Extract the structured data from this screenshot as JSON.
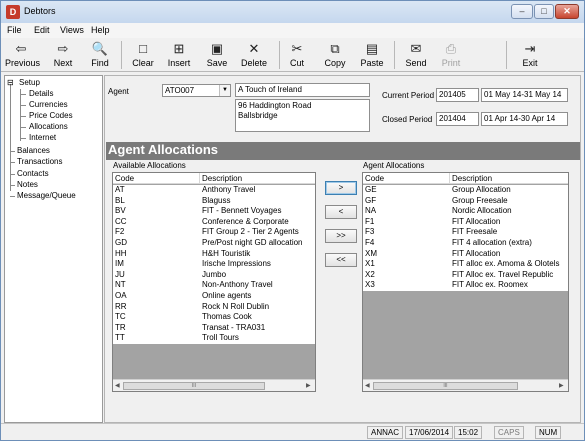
{
  "window": {
    "title": "Debtors",
    "icon_letter": "D"
  },
  "menu": [
    "File",
    "Edit",
    "Views",
    "Help"
  ],
  "toolbar": [
    {
      "label": "Previous",
      "icon": "previous-icon",
      "glyph": "⇦",
      "enabled": true
    },
    {
      "label": "Next",
      "icon": "next-icon",
      "glyph": "⇨",
      "enabled": true
    },
    {
      "label": "Find",
      "icon": "binoculars-icon",
      "glyph": "🔍",
      "enabled": true
    },
    {
      "label": "Clear",
      "icon": "clear-page-icon",
      "glyph": "□",
      "enabled": true
    },
    {
      "label": "Insert",
      "icon": "insert-page-icon",
      "glyph": "⊞",
      "enabled": true
    },
    {
      "label": "Save",
      "icon": "save-icon",
      "glyph": "▣",
      "enabled": true
    },
    {
      "label": "Delete",
      "icon": "delete-icon",
      "glyph": "✕",
      "enabled": true
    },
    {
      "label": "Cut",
      "icon": "scissors-icon",
      "glyph": "✂",
      "enabled": true
    },
    {
      "label": "Copy",
      "icon": "copy-icon",
      "glyph": "⧉",
      "enabled": true
    },
    {
      "label": "Paste",
      "icon": "paste-icon",
      "glyph": "▤",
      "enabled": true
    },
    {
      "label": "Send",
      "icon": "send-icon",
      "glyph": "✉",
      "enabled": true
    },
    {
      "label": "Print",
      "icon": "printer-icon",
      "glyph": "⎙",
      "enabled": false
    },
    {
      "label": "Exit",
      "icon": "exit-door-icon",
      "glyph": "⇥",
      "enabled": true
    }
  ],
  "nav": {
    "setup": "Setup",
    "setup_children": [
      "Details",
      "Currencies",
      "Price Codes",
      "Allocations",
      "Internet"
    ],
    "top_items": [
      "Balances",
      "Transactions",
      "Contacts",
      "Notes",
      "Message/Queue"
    ]
  },
  "agent": {
    "label": "Agent",
    "code": "ATO007",
    "name": "A Touch of Ireland",
    "address_line1": "96 Haddington Road",
    "address_line2": "Ballsbridge"
  },
  "periods": {
    "current_label": "Current Period",
    "current_code": "201405",
    "current_range": "01 May 14-31 May 14",
    "closed_label": "Closed Period",
    "closed_code": "201404",
    "closed_range": "01 Apr 14-30 Apr 14"
  },
  "section_title": "Agent Allocations",
  "available": {
    "caption": "Available Allocations",
    "col_code": "Code",
    "col_desc": "Description",
    "rows": [
      {
        "code": "AT",
        "desc": "Anthony Travel"
      },
      {
        "code": "BL",
        "desc": "Blaguss"
      },
      {
        "code": "BV",
        "desc": "FIT - Bennett Voyages"
      },
      {
        "code": "CC",
        "desc": "Conference & Corporate"
      },
      {
        "code": "F2",
        "desc": "FIT Group 2 - Tier 2 Agents"
      },
      {
        "code": "GD",
        "desc": "Pre/Post night GD allocation"
      },
      {
        "code": "HH",
        "desc": "H&H Touristik"
      },
      {
        "code": "IM",
        "desc": "Irische Impressions"
      },
      {
        "code": "JU",
        "desc": "Jumbo"
      },
      {
        "code": "NT",
        "desc": "Non-Anthony Travel"
      },
      {
        "code": "OA",
        "desc": "Online agents"
      },
      {
        "code": "RR",
        "desc": "Rock N Roll Dublin"
      },
      {
        "code": "TC",
        "desc": "Thomas Cook"
      },
      {
        "code": "TR",
        "desc": "Transat - TRA031"
      },
      {
        "code": "TT",
        "desc": "Troll Tours"
      }
    ]
  },
  "agent_alloc": {
    "caption": "Agent Allocations",
    "col_code": "Code",
    "col_desc": "Description",
    "rows": [
      {
        "code": "GE",
        "desc": "Group Allocation"
      },
      {
        "code": "GF",
        "desc": "Group Freesale"
      },
      {
        "code": "NA",
        "desc": "Nordic Allocation"
      },
      {
        "code": "F1",
        "desc": "FIT Allocation"
      },
      {
        "code": "F3",
        "desc": "FIT Freesale"
      },
      {
        "code": "F4",
        "desc": "FIT 4 allocation (extra)"
      },
      {
        "code": "XM",
        "desc": "FIT Allocation"
      },
      {
        "code": "X1",
        "desc": "FIT alloc ex. Amoma & Olotels"
      },
      {
        "code": "X2",
        "desc": "FIT Alloc ex. Travel Republic"
      },
      {
        "code": "X3",
        "desc": "FIT Alloc ex. Roomex"
      }
    ]
  },
  "move_buttons": [
    ">",
    "<",
    ">>",
    "<<"
  ],
  "scroll_thumb": "III",
  "status": {
    "user": "ANNAC",
    "date": "17/06/2014",
    "time": "15:02",
    "caps": "CAPS",
    "num": "NUM"
  },
  "colors": {
    "section_bar": "#7a7a7a",
    "list_empty": "#a3a3a3",
    "titlebar": "#c5d7ee"
  }
}
